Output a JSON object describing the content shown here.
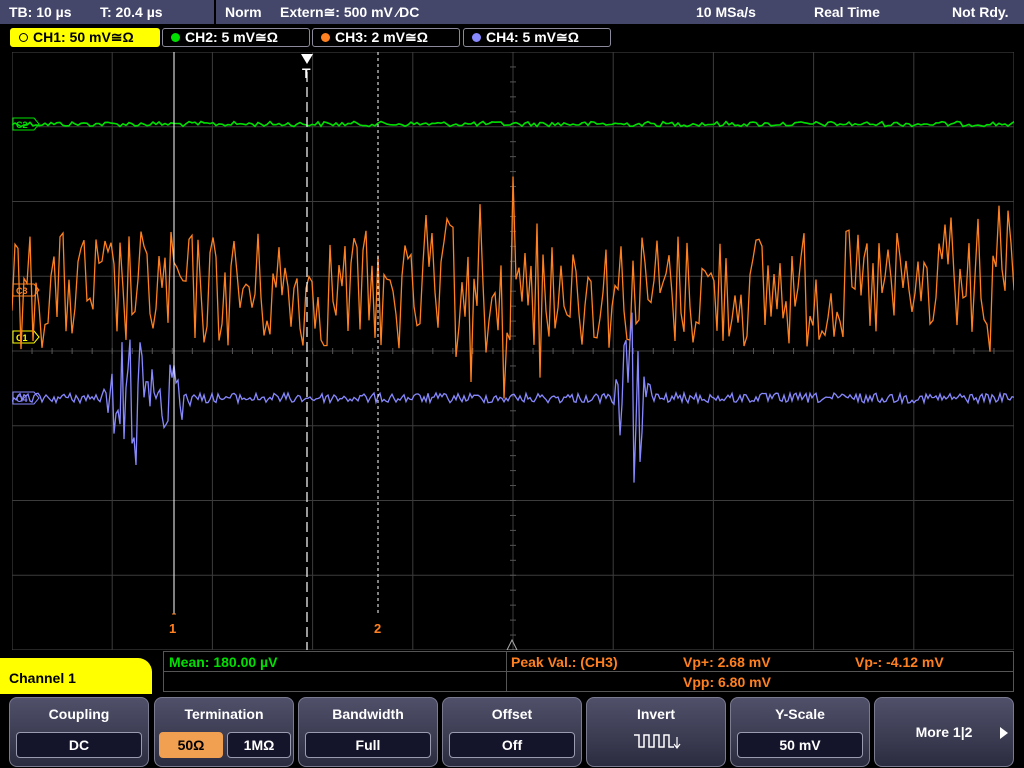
{
  "status": {
    "timebase": "TB: 10 µs",
    "trigger_time": "T: 20.4 µs",
    "mode": "Norm",
    "trigger_source": "Extern≅: 500 mV ⁄DC",
    "sample_rate": "10 MSa/s",
    "acq_mode": "Real Time",
    "ready": "Not Rdy."
  },
  "channels": [
    {
      "label": "CH1: 50 mV≅Ω",
      "color": "#ffff00"
    },
    {
      "label": "CH2: 5 mV≅Ω",
      "color": "#00e000"
    },
    {
      "label": "CH3: 2 mV≅Ω",
      "color": "#ff8020"
    },
    {
      "label": "CH4: 5 mV≅Ω",
      "color": "#8888ff"
    }
  ],
  "markers": {
    "trigger": "T",
    "ch1": "C1",
    "ch2": "C2",
    "ch3": "C3",
    "ch4": "C4",
    "cursor1": "1",
    "cursor2": "2"
  },
  "measurements": {
    "mean": "Mean: 180.00 µV",
    "peak_label": "Peak Val.:  (CH3)",
    "vp_plus": "Vp+: 2.68 mV",
    "vp_minus": "Vp-: -4.12 mV",
    "vpp": "Vpp: 6.80 mV"
  },
  "panel_title": "Channel 1",
  "softkeys": {
    "coupling": {
      "title": "Coupling",
      "value": "DC"
    },
    "termination": {
      "title": "Termination",
      "opt1": "50Ω",
      "opt2": "1MΩ"
    },
    "bandwidth": {
      "title": "Bandwidth",
      "value": "Full"
    },
    "offset": {
      "title": "Offset",
      "value": "Off"
    },
    "invert": {
      "title": "Invert",
      "icon": "inverted-square-wave-icon"
    },
    "yscale": {
      "title": "Y-Scale",
      "value": "50 mV"
    },
    "more": {
      "label": "More 1|2"
    }
  },
  "colors": {
    "ch1": "#ffff00",
    "ch2": "#00e000",
    "ch3": "#ff8020",
    "ch4": "#8888ff",
    "grid": "#4a4a4a",
    "panel": "#44476a"
  }
}
